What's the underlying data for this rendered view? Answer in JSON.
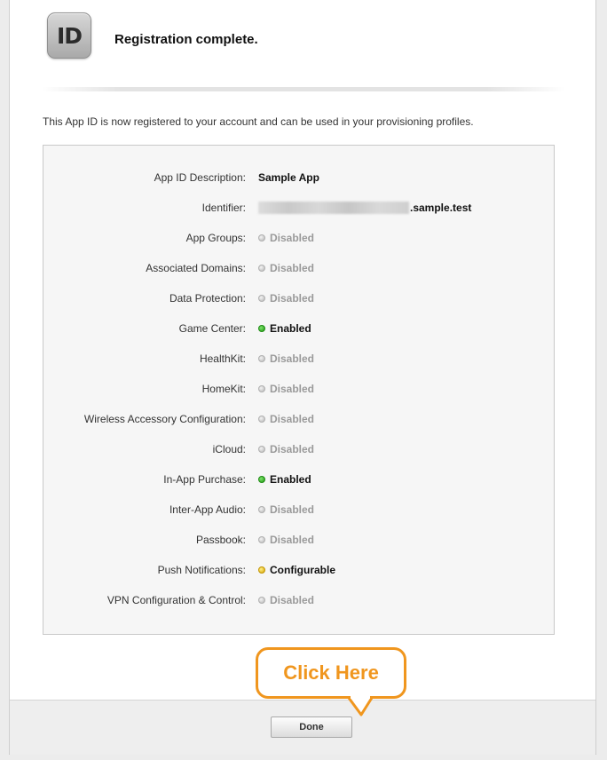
{
  "header": {
    "icon_text": "ID",
    "title": "Registration complete."
  },
  "intro_text": "This App ID is now registered to your account and can be used in your provisioning profiles.",
  "details": {
    "description": {
      "label": "App ID Description:",
      "value": "Sample App"
    },
    "identifier": {
      "label": "Identifier:",
      "value_suffix": ".sample.test"
    },
    "services": [
      {
        "label": "App Groups:",
        "status": "Disabled"
      },
      {
        "label": "Associated Domains:",
        "status": "Disabled"
      },
      {
        "label": "Data Protection:",
        "status": "Disabled"
      },
      {
        "label": "Game Center:",
        "status": "Enabled"
      },
      {
        "label": "HealthKit:",
        "status": "Disabled"
      },
      {
        "label": "HomeKit:",
        "status": "Disabled"
      },
      {
        "label": "Wireless Accessory Configuration:",
        "status": "Disabled"
      },
      {
        "label": "iCloud:",
        "status": "Disabled"
      },
      {
        "label": "In-App Purchase:",
        "status": "Enabled"
      },
      {
        "label": "Inter-App Audio:",
        "status": "Disabled"
      },
      {
        "label": "Passbook:",
        "status": "Disabled"
      },
      {
        "label": "Push Notifications:",
        "status": "Configurable"
      },
      {
        "label": "VPN Configuration & Control:",
        "status": "Disabled"
      }
    ]
  },
  "callout": {
    "text": "Click Here"
  },
  "footer": {
    "done_label": "Done"
  },
  "colors": {
    "enabled": "#1f9a12",
    "configurable": "#d7a400",
    "disabled": "#b4b4b4",
    "callout_accent": "#f0961e"
  }
}
